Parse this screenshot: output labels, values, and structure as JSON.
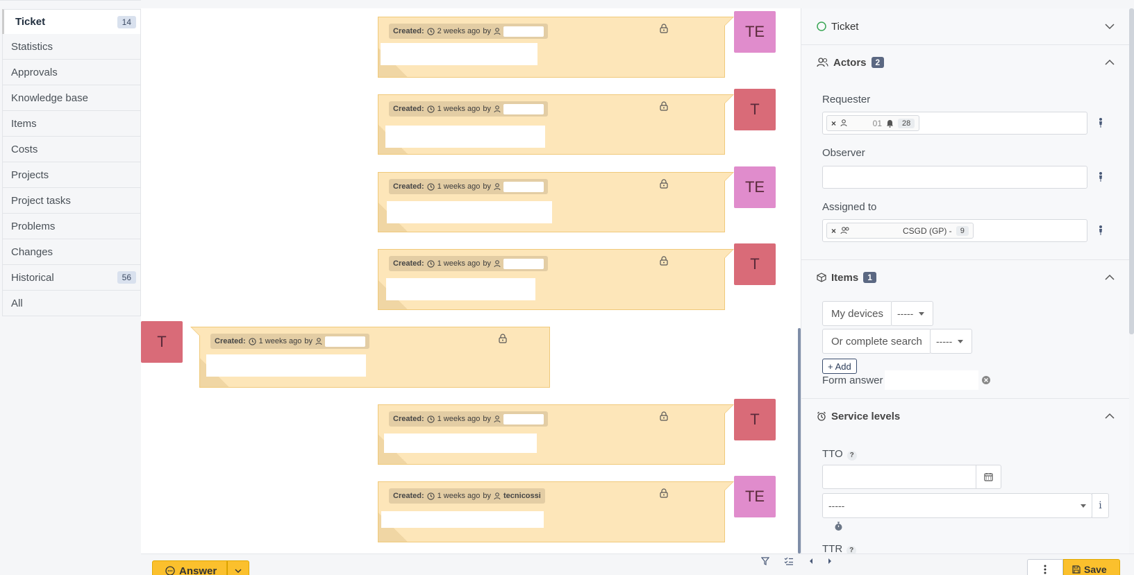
{
  "nav": {
    "items": [
      {
        "label": "Ticket",
        "badge": "14"
      },
      {
        "label": "Statistics"
      },
      {
        "label": "Approvals"
      },
      {
        "label": "Knowledge base"
      },
      {
        "label": "Items"
      },
      {
        "label": "Costs"
      },
      {
        "label": "Projects"
      },
      {
        "label": "Project tasks"
      },
      {
        "label": "Problems"
      },
      {
        "label": "Changes"
      },
      {
        "label": "Historical",
        "badge": "56"
      },
      {
        "label": "All"
      }
    ]
  },
  "timeline": {
    "created_label": "Created:",
    "by_label": "by",
    "entries": [
      {
        "time": "2 weeks ago",
        "avatar": "TE",
        "avatar_color": "#e08ccc",
        "author": ""
      },
      {
        "time": "1 weeks ago",
        "avatar": "T",
        "avatar_color": "#d96b78",
        "author": ""
      },
      {
        "time": "1 weeks ago",
        "avatar": "TE",
        "avatar_color": "#e08ccc",
        "author": ""
      },
      {
        "time": "1 weeks ago",
        "avatar": "T",
        "avatar_color": "#d96b78",
        "author": ""
      },
      {
        "time": "1 weeks ago",
        "avatar": "T",
        "avatar_color": "#d96b78",
        "author": ""
      },
      {
        "time": "1 weeks ago",
        "avatar": "T",
        "avatar_color": "#d96b78",
        "author": ""
      },
      {
        "time": "1 weeks ago",
        "avatar": "TE",
        "avatar_color": "#e08ccc",
        "author": "tecnicossi"
      }
    ]
  },
  "bottombar": {
    "answer_label": "Answer"
  },
  "panel": {
    "ticket_label": "Ticket",
    "actors": {
      "title": "Actors",
      "count": "2",
      "requester_label": "Requester",
      "requester_tag_text": "01",
      "requester_tag_count": "28",
      "observer_label": "Observer",
      "assigned_label": "Assigned to",
      "assigned_tag_text": "CSGD (GP) -",
      "assigned_tag_count": "9"
    },
    "items": {
      "title": "Items",
      "count": "1",
      "my_devices_label": "My devices",
      "my_devices_value": "-----",
      "complete_search_label": "Or complete search",
      "complete_search_value": "-----",
      "add_label": "Add",
      "form_answer_label": "Form answer"
    },
    "service_levels": {
      "title": "Service levels",
      "tto_label": "TTO",
      "tto_select": "-----",
      "ttr_label": "TTR",
      "help_mark": "?",
      "info_mark": "i"
    },
    "save_label": "Save"
  },
  "colors": {
    "bubble": "#fde6b9",
    "accent_yellow": "#fbc02d",
    "badge_dark": "#5b6882"
  }
}
